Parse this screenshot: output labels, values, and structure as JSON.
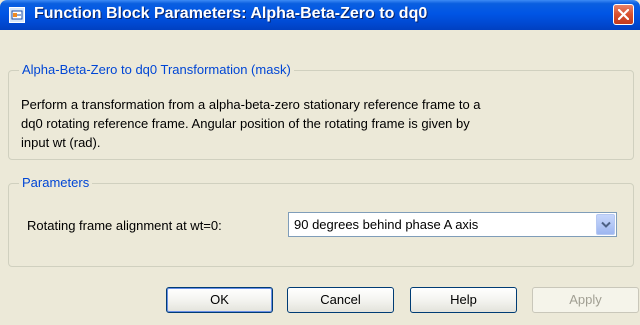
{
  "window": {
    "title": "Function Block Parameters: Alpha-Beta-Zero to dq0",
    "close_icon": "close-icon",
    "app_icon": "simulink-block-icon",
    "colors": {
      "titlebar": "#0055e5",
      "legend_text": "#0046d5",
      "background": "#ece9d8"
    }
  },
  "mask_group": {
    "legend": "Alpha-Beta-Zero to dq0 Transformation (mask)",
    "description_lines": [
      "Perform a transformation from a alpha-beta-zero stationary reference frame to a",
      "dq0 rotating reference frame. Angular position of the rotating frame is given by",
      "input wt (rad)."
    ]
  },
  "parameters_group": {
    "legend": "Parameters",
    "alignment_label": "Rotating frame alignment at wt=0:",
    "alignment_value": "90 degrees behind phase A axis",
    "dropdown_icon": "chevron-down-icon"
  },
  "buttons": {
    "ok": "OK",
    "cancel": "Cancel",
    "help": "Help",
    "apply": "Apply"
  }
}
